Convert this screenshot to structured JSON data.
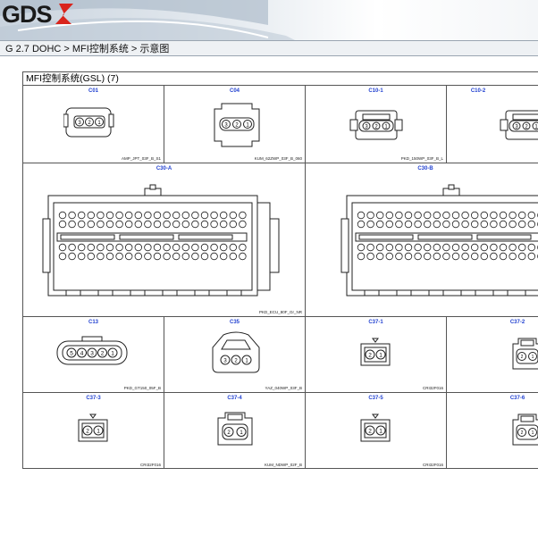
{
  "header": {
    "logo_text": "GDS",
    "colors": {
      "brand_red": "#d9241c",
      "brand_dark": "#1a1a1a"
    }
  },
  "breadcrumb": "G 2.7 DOHC > MFI控制系统 > 示意图",
  "panel": {
    "title": "MFI控制系统(GSL) (7)",
    "connectors": [
      {
        "id": "C01",
        "part": "AMP_JPT_03F_B_S1"
      },
      {
        "id": "C04",
        "part": "KUM_62ZWP_03F_B_060"
      },
      {
        "id": "C10-1",
        "part": "PKD_150WP_03F_B_L"
      },
      {
        "id": "C10-2",
        "part": "P"
      },
      {
        "id": "C30-A",
        "part": "PKD_ECU_80F_Gr_NR"
      },
      {
        "id": "C30-B",
        "part": ""
      },
      {
        "id": "C13",
        "part": "PKD_GT150_05F_B"
      },
      {
        "id": "C35",
        "part": "YAZ_040WP_03F_B"
      },
      {
        "id": "C37-1",
        "part": "CRI32F016"
      },
      {
        "id": "C37-2",
        "part": ""
      },
      {
        "id": "C37-3",
        "part": "CRI32F016"
      },
      {
        "id": "C37-4",
        "part": "KUM_NDWP_02F_B"
      },
      {
        "id": "C37-5",
        "part": "CRI32F016"
      },
      {
        "id": "C37-6",
        "part": ""
      }
    ]
  }
}
